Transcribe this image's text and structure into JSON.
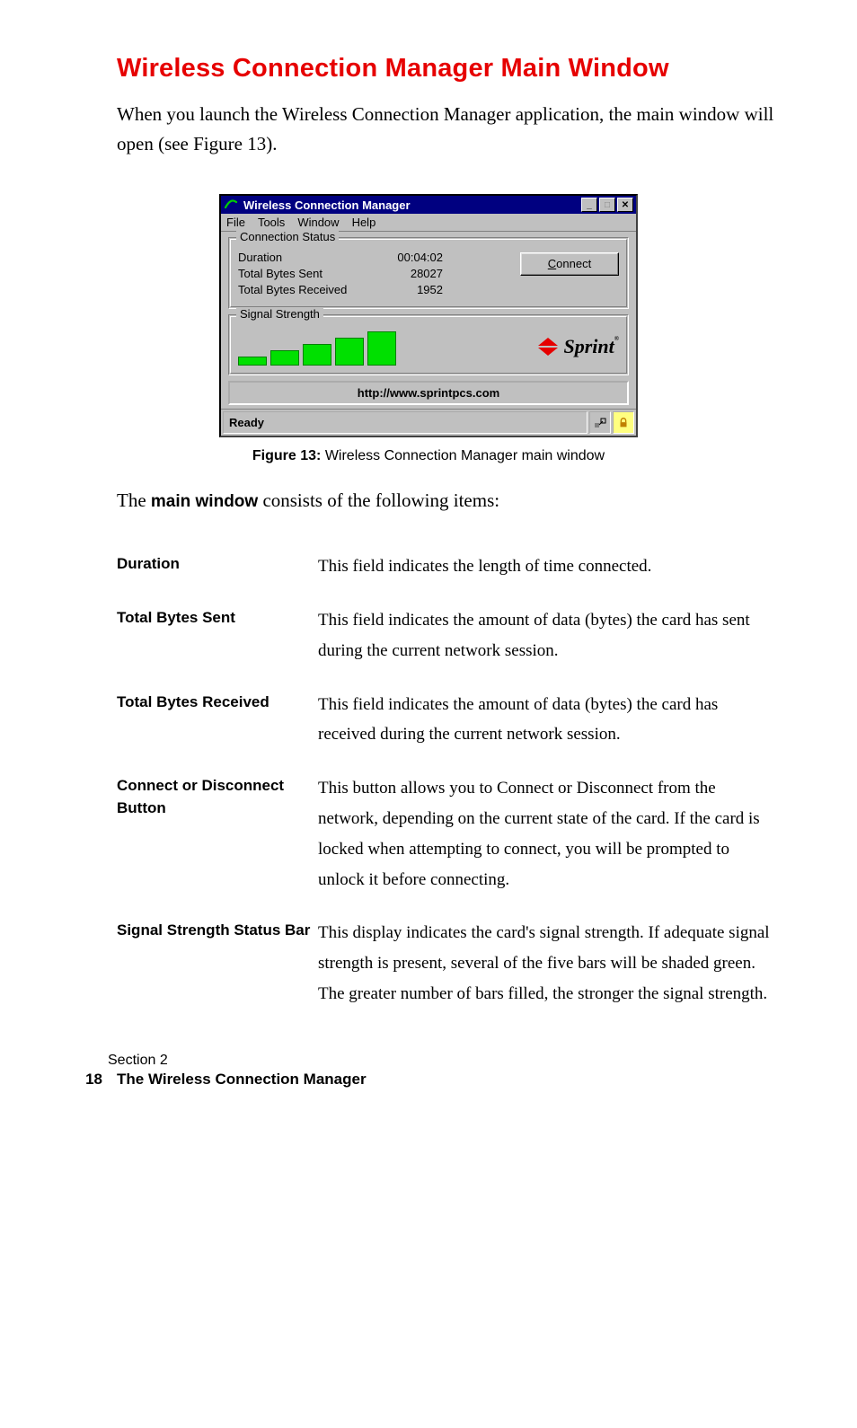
{
  "heading": "Wireless Connection Manager Main Window",
  "intro": "When you launch the Wireless Connection Manager application, the main window will open (see Figure 13).",
  "window": {
    "title": "Wireless Connection Manager",
    "menu": {
      "file": "File",
      "tools": "Tools",
      "window": "Window",
      "help": "Help"
    },
    "group_conn": "Connection Status",
    "duration_label": "Duration",
    "duration_value": "00:04:02",
    "sent_label": "Total Bytes Sent",
    "sent_value": "28027",
    "recv_label": "Total Bytes Received",
    "recv_value": "1952",
    "connect_label": "onnect",
    "connect_accel": "C",
    "group_signal": "Signal Strength",
    "logo_text": "Sprint",
    "logo_reg": "®",
    "url": "http://www.sprintpcs.com",
    "status": "Ready",
    "min": "_",
    "max": "□",
    "close": "✕"
  },
  "caption_prefix": "Figure 13:",
  "caption_text": " Wireless Connection Manager main window",
  "consists_pre": "The ",
  "consists_bold": "main window",
  "consists_post": " consists of the following items:",
  "defs": {
    "duration": {
      "t": "Duration",
      "d": "This field indicates the length of time connected."
    },
    "sent": {
      "t": "Total Bytes Sent",
      "d": "This field indicates the amount of data (bytes) the card has sent during the current network session."
    },
    "recv": {
      "t": "Total Bytes Received",
      "d": "This field indicates the amount of data (bytes) the card has received during the current network session."
    },
    "connect": {
      "t": "Connect or Disconnect Button",
      "d": "This button allows you to Connect or Disconnect from the network, depending on the current state of the card. If the card is locked when attempting to connect, you will be prompted to unlock it before connecting."
    },
    "signal": {
      "t": "Signal Strength Status Bar",
      "d": "This display indicates the card's signal strength. If adequate signal strength is present, several of the five bars will be shaded green. The greater number of bars filled, the stronger the signal strength."
    }
  },
  "footer": {
    "section": "Section 2",
    "pagenum": "18",
    "chapter": "The Wireless Connection Manager"
  }
}
